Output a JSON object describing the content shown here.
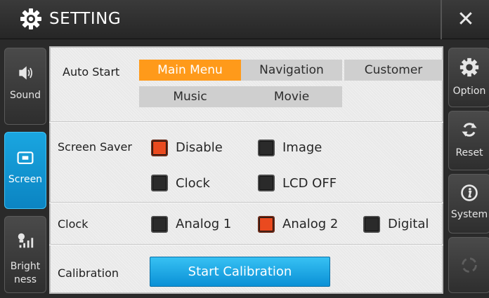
{
  "title": "SETTING",
  "close_symbol": "✕",
  "left_nav": [
    {
      "label": "Sound",
      "icon": "speaker-icon"
    },
    {
      "label": "Screen",
      "icon": "screen-icon"
    },
    {
      "label_line1": "Bright",
      "label_line2": "ness",
      "icon": "brightness-icon"
    }
  ],
  "right_nav": [
    {
      "label": "Option",
      "icon": "gear-icon"
    },
    {
      "label": "Reset",
      "icon": "reset-icon"
    },
    {
      "label": "System",
      "icon": "info-icon"
    },
    {
      "label": "",
      "icon": "loading-icon"
    }
  ],
  "auto_start": {
    "label": "Auto Start",
    "options": [
      "Main Menu",
      "Navigation",
      "Customer",
      "Music",
      "Movie"
    ],
    "selected": "Main Menu"
  },
  "screen_saver": {
    "label": "Screen Saver",
    "options": [
      {
        "label": "Disable",
        "checked": true
      },
      {
        "label": "Image",
        "checked": false
      },
      {
        "label": "Clock",
        "checked": false
      },
      {
        "label": "LCD OFF",
        "checked": false
      }
    ]
  },
  "clock": {
    "label": "Clock",
    "options": [
      {
        "label": "Analog 1",
        "checked": false
      },
      {
        "label": "Analog 2",
        "checked": true
      },
      {
        "label": "Digital",
        "checked": false
      }
    ]
  },
  "calibration": {
    "label": "Calibration",
    "button": "Start Calibration"
  },
  "colors": {
    "accent_blue": "#0b84c2",
    "selected_orange": "#ff9a1a",
    "checked_red": "#ea4a1f"
  }
}
